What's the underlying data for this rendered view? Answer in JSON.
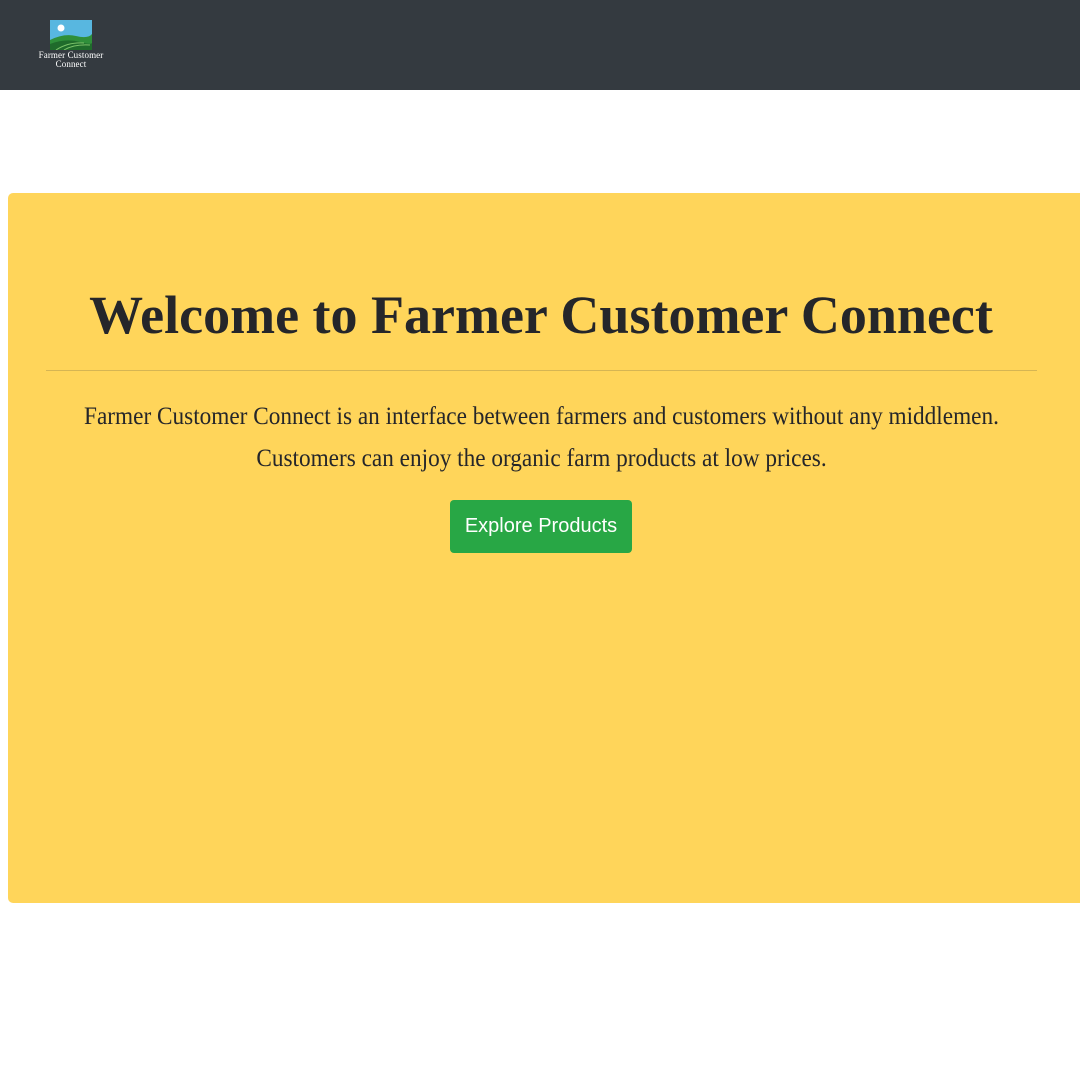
{
  "navbar": {
    "logo": {
      "icon": "farm-landscape-logo-icon",
      "line1": "Farmer Customer",
      "line2": "Connect"
    }
  },
  "hero": {
    "title": "Welcome to Farmer Customer Connect",
    "description_line1": "Farmer Customer Connect is an interface between farmers and customers without any middlemen.",
    "description_line2": "Customers can enjoy the organic farm products at low prices.",
    "cta_label": "Explore Products"
  },
  "colors": {
    "navbar": "#343a40",
    "hero_background": "#ffd55a",
    "button": "#28a745",
    "text": "#25262a"
  }
}
